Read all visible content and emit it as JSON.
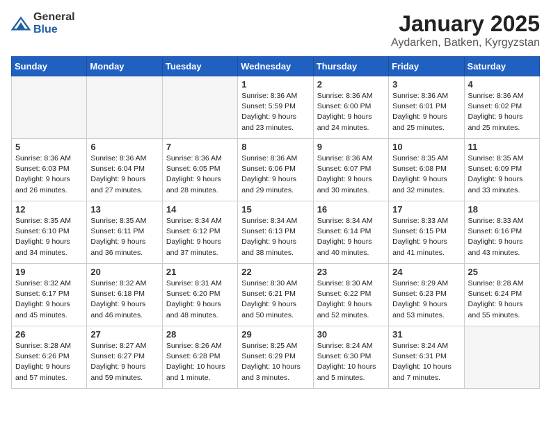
{
  "header": {
    "logo_general": "General",
    "logo_blue": "Blue",
    "month": "January 2025",
    "location": "Aydarken, Batken, Kyrgyzstan"
  },
  "weekdays": [
    "Sunday",
    "Monday",
    "Tuesday",
    "Wednesday",
    "Thursday",
    "Friday",
    "Saturday"
  ],
  "weeks": [
    [
      {
        "day": "",
        "info": ""
      },
      {
        "day": "",
        "info": ""
      },
      {
        "day": "",
        "info": ""
      },
      {
        "day": "1",
        "info": "Sunrise: 8:36 AM\nSunset: 5:59 PM\nDaylight: 9 hours\nand 23 minutes."
      },
      {
        "day": "2",
        "info": "Sunrise: 8:36 AM\nSunset: 6:00 PM\nDaylight: 9 hours\nand 24 minutes."
      },
      {
        "day": "3",
        "info": "Sunrise: 8:36 AM\nSunset: 6:01 PM\nDaylight: 9 hours\nand 25 minutes."
      },
      {
        "day": "4",
        "info": "Sunrise: 8:36 AM\nSunset: 6:02 PM\nDaylight: 9 hours\nand 25 minutes."
      }
    ],
    [
      {
        "day": "5",
        "info": "Sunrise: 8:36 AM\nSunset: 6:03 PM\nDaylight: 9 hours\nand 26 minutes."
      },
      {
        "day": "6",
        "info": "Sunrise: 8:36 AM\nSunset: 6:04 PM\nDaylight: 9 hours\nand 27 minutes."
      },
      {
        "day": "7",
        "info": "Sunrise: 8:36 AM\nSunset: 6:05 PM\nDaylight: 9 hours\nand 28 minutes."
      },
      {
        "day": "8",
        "info": "Sunrise: 8:36 AM\nSunset: 6:06 PM\nDaylight: 9 hours\nand 29 minutes."
      },
      {
        "day": "9",
        "info": "Sunrise: 8:36 AM\nSunset: 6:07 PM\nDaylight: 9 hours\nand 30 minutes."
      },
      {
        "day": "10",
        "info": "Sunrise: 8:35 AM\nSunset: 6:08 PM\nDaylight: 9 hours\nand 32 minutes."
      },
      {
        "day": "11",
        "info": "Sunrise: 8:35 AM\nSunset: 6:09 PM\nDaylight: 9 hours\nand 33 minutes."
      }
    ],
    [
      {
        "day": "12",
        "info": "Sunrise: 8:35 AM\nSunset: 6:10 PM\nDaylight: 9 hours\nand 34 minutes."
      },
      {
        "day": "13",
        "info": "Sunrise: 8:35 AM\nSunset: 6:11 PM\nDaylight: 9 hours\nand 36 minutes."
      },
      {
        "day": "14",
        "info": "Sunrise: 8:34 AM\nSunset: 6:12 PM\nDaylight: 9 hours\nand 37 minutes."
      },
      {
        "day": "15",
        "info": "Sunrise: 8:34 AM\nSunset: 6:13 PM\nDaylight: 9 hours\nand 38 minutes."
      },
      {
        "day": "16",
        "info": "Sunrise: 8:34 AM\nSunset: 6:14 PM\nDaylight: 9 hours\nand 40 minutes."
      },
      {
        "day": "17",
        "info": "Sunrise: 8:33 AM\nSunset: 6:15 PM\nDaylight: 9 hours\nand 41 minutes."
      },
      {
        "day": "18",
        "info": "Sunrise: 8:33 AM\nSunset: 6:16 PM\nDaylight: 9 hours\nand 43 minutes."
      }
    ],
    [
      {
        "day": "19",
        "info": "Sunrise: 8:32 AM\nSunset: 6:17 PM\nDaylight: 9 hours\nand 45 minutes."
      },
      {
        "day": "20",
        "info": "Sunrise: 8:32 AM\nSunset: 6:18 PM\nDaylight: 9 hours\nand 46 minutes."
      },
      {
        "day": "21",
        "info": "Sunrise: 8:31 AM\nSunset: 6:20 PM\nDaylight: 9 hours\nand 48 minutes."
      },
      {
        "day": "22",
        "info": "Sunrise: 8:30 AM\nSunset: 6:21 PM\nDaylight: 9 hours\nand 50 minutes."
      },
      {
        "day": "23",
        "info": "Sunrise: 8:30 AM\nSunset: 6:22 PM\nDaylight: 9 hours\nand 52 minutes."
      },
      {
        "day": "24",
        "info": "Sunrise: 8:29 AM\nSunset: 6:23 PM\nDaylight: 9 hours\nand 53 minutes."
      },
      {
        "day": "25",
        "info": "Sunrise: 8:28 AM\nSunset: 6:24 PM\nDaylight: 9 hours\nand 55 minutes."
      }
    ],
    [
      {
        "day": "26",
        "info": "Sunrise: 8:28 AM\nSunset: 6:26 PM\nDaylight: 9 hours\nand 57 minutes."
      },
      {
        "day": "27",
        "info": "Sunrise: 8:27 AM\nSunset: 6:27 PM\nDaylight: 9 hours\nand 59 minutes."
      },
      {
        "day": "28",
        "info": "Sunrise: 8:26 AM\nSunset: 6:28 PM\nDaylight: 10 hours\nand 1 minute."
      },
      {
        "day": "29",
        "info": "Sunrise: 8:25 AM\nSunset: 6:29 PM\nDaylight: 10 hours\nand 3 minutes."
      },
      {
        "day": "30",
        "info": "Sunrise: 8:24 AM\nSunset: 6:30 PM\nDaylight: 10 hours\nand 5 minutes."
      },
      {
        "day": "31",
        "info": "Sunrise: 8:24 AM\nSunset: 6:31 PM\nDaylight: 10 hours\nand 7 minutes."
      },
      {
        "day": "",
        "info": ""
      }
    ]
  ]
}
